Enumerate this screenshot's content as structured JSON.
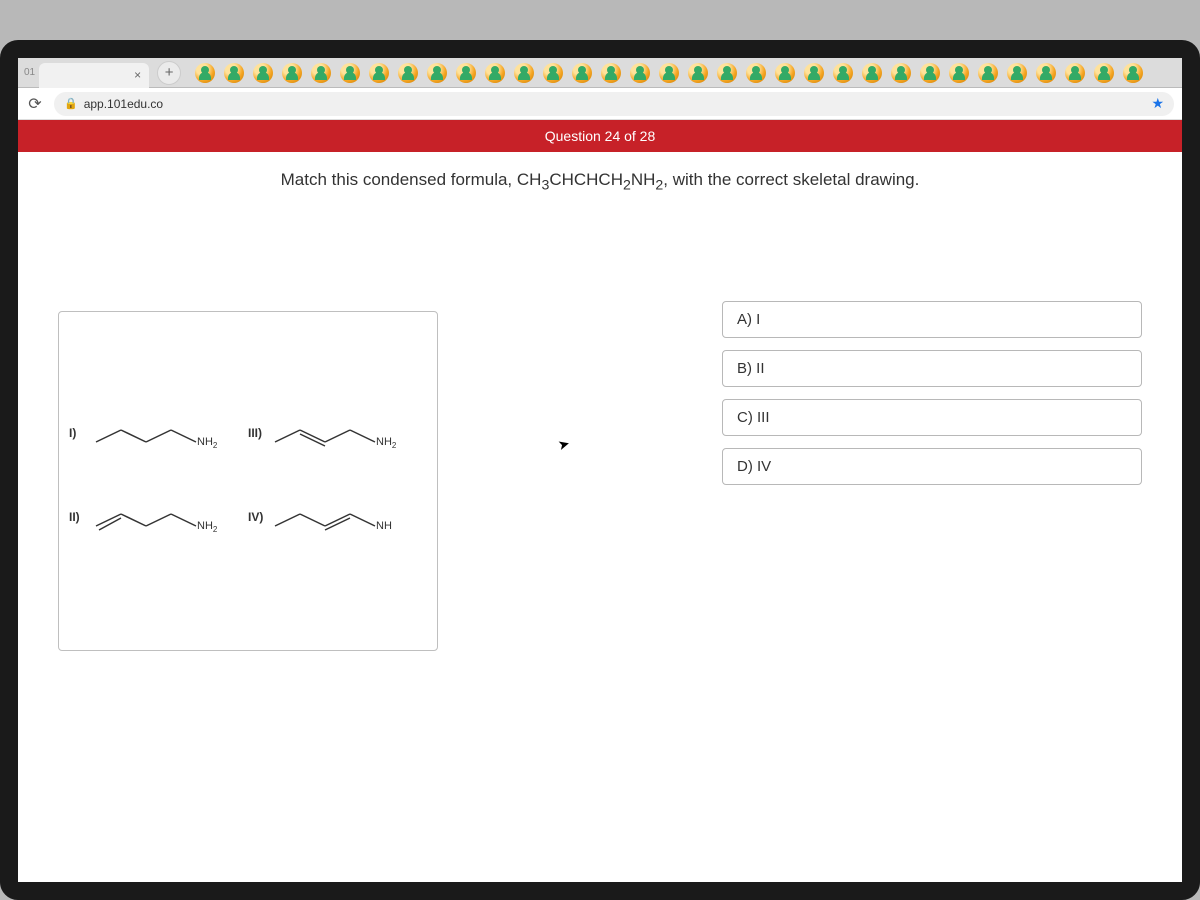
{
  "browser": {
    "tab_label_partial": "01",
    "url_host": "app.101edu.co"
  },
  "header": {
    "question_indicator": "Question 24 of 28"
  },
  "prompt": {
    "pre": "Match this condensed formula, CH",
    "sub1": "3",
    "mid1": "CHCHCH",
    "sub2": "2",
    "mid2": "NH",
    "sub3": "2",
    "post": ", with the correct skeletal drawing."
  },
  "structures": [
    {
      "label": "I)",
      "end": "NH",
      "end_sub": "2",
      "type": "sat4"
    },
    {
      "label": "III)",
      "end": "NH",
      "end_sub": "2",
      "type": "db23"
    },
    {
      "label": "II)",
      "end": "NH",
      "end_sub": "2",
      "type": "db12"
    },
    {
      "label": "IV)",
      "end": "NH",
      "end_sub": "",
      "type": "db34"
    }
  ],
  "answers": [
    {
      "text": "A) I"
    },
    {
      "text": "B) II"
    },
    {
      "text": "C) III"
    },
    {
      "text": "D) IV"
    }
  ]
}
